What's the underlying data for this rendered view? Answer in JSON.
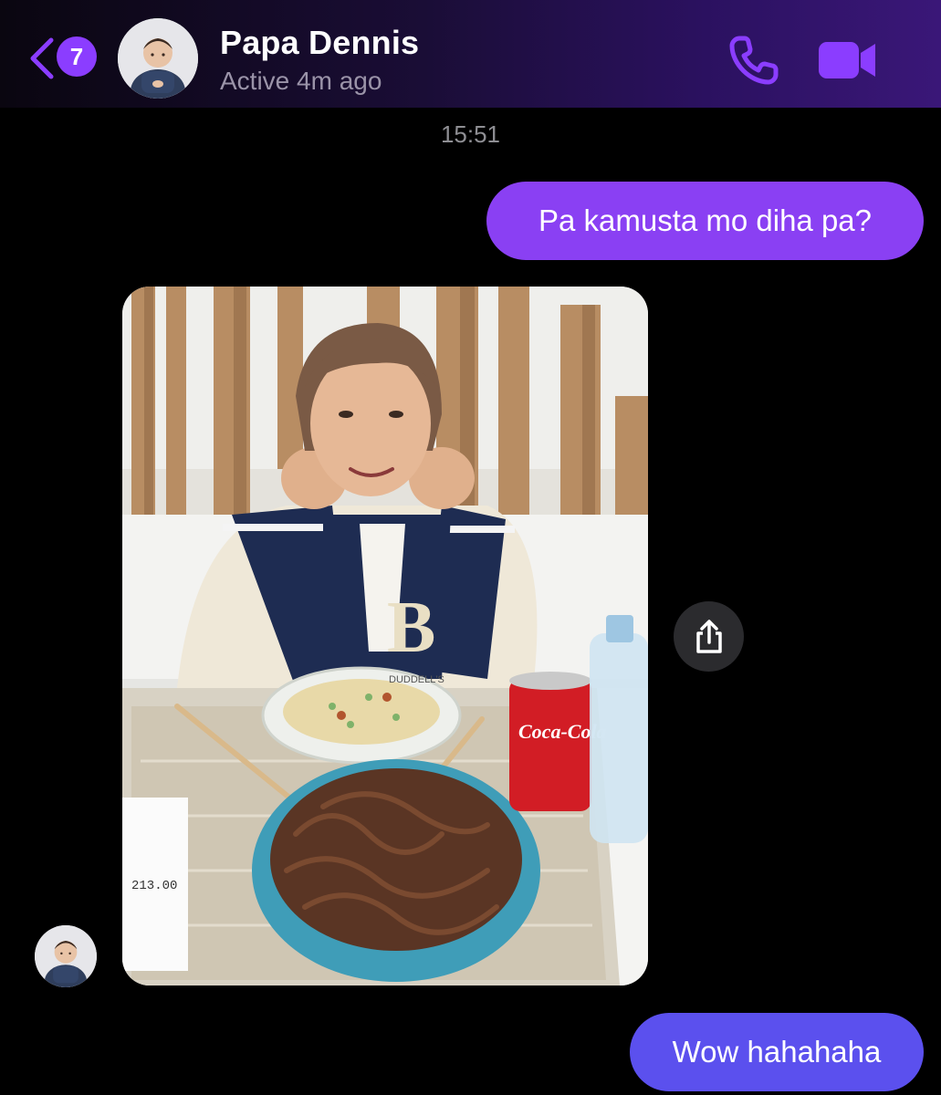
{
  "header": {
    "back_badge_count": "7",
    "contact_name": "Papa Dennis",
    "contact_status": "Active 4m ago"
  },
  "chat": {
    "timestamp": "15:51",
    "messages": [
      {
        "direction": "outgoing",
        "type": "text",
        "text": "Pa kamusta mo diha pa?"
      },
      {
        "direction": "incoming",
        "type": "photo",
        "receipt_total": "213.00",
        "can_label": "Coca-Cola",
        "bowl_label": "DUDDELL'S"
      },
      {
        "direction": "outgoing",
        "type": "text",
        "text": "Wow hahahaha"
      }
    ]
  },
  "colors": {
    "accent": "#8b3dff",
    "outgoing_bubble_top": "#8a40f3",
    "outgoing_bubble_bottom": "#5b50ee",
    "status_text": "#9a93a8",
    "background": "#000000"
  },
  "icons": [
    "chevron-left-icon",
    "phone-icon",
    "video-camera-icon",
    "share-icon"
  ]
}
